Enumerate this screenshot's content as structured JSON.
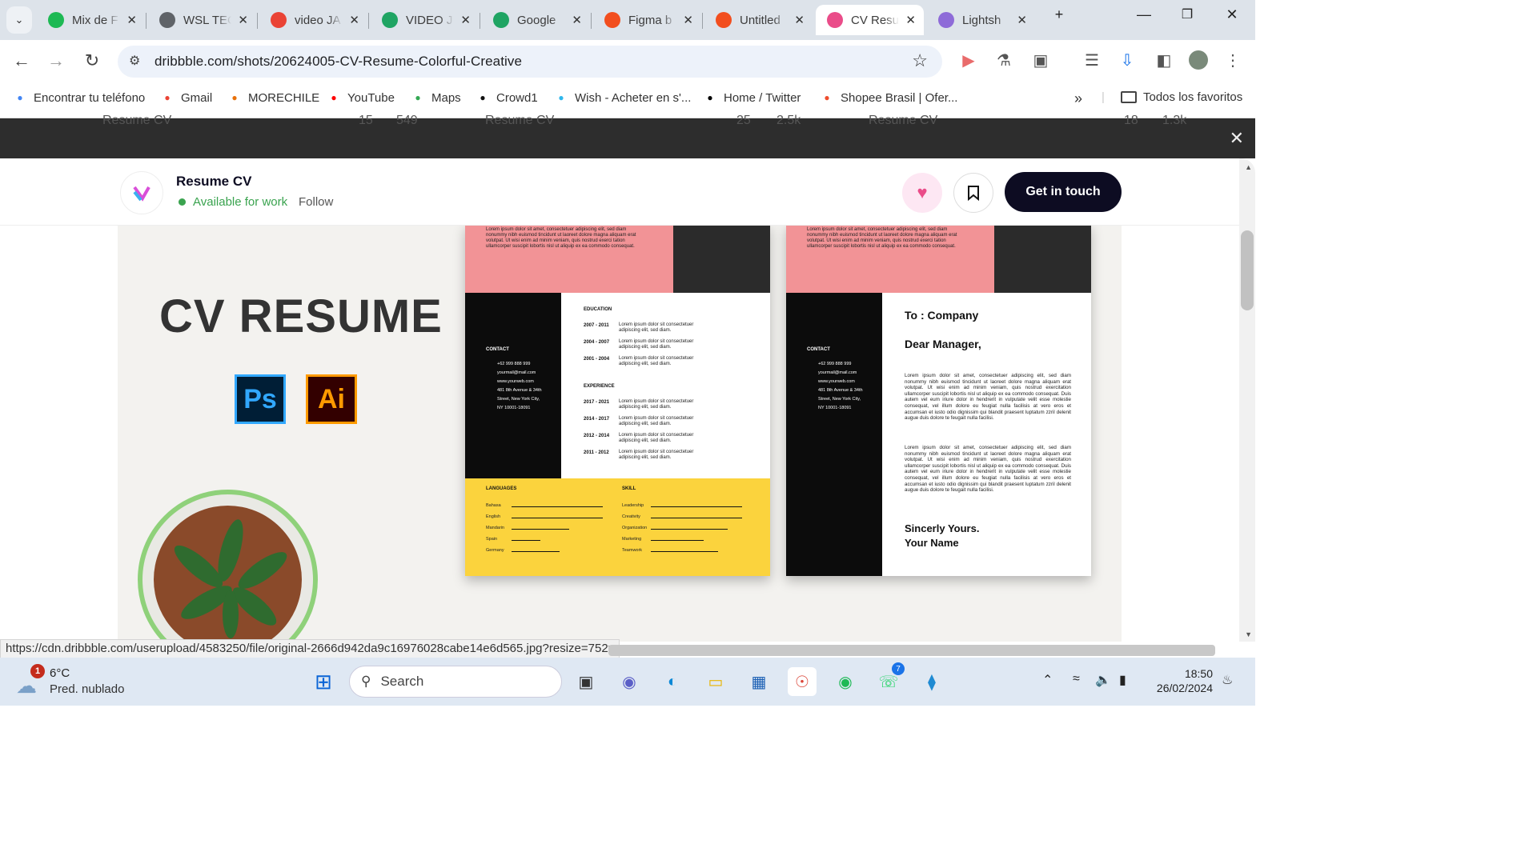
{
  "tabs": [
    {
      "label": "Mix de F",
      "icon": "spotify-icon",
      "color": "#1db954"
    },
    {
      "label": "WSL TEC",
      "icon": "globe-icon",
      "color": "#5f6368"
    },
    {
      "label": "video JA",
      "icon": "gmail-icon",
      "color": "#ea4335"
    },
    {
      "label": "VIDEO J",
      "icon": "drive-icon",
      "color": "#1fa463"
    },
    {
      "label": "Google",
      "icon": "drive-icon",
      "color": "#1fa463"
    },
    {
      "label": "Figma b",
      "icon": "figma-icon",
      "color": "#f24e1e"
    },
    {
      "label": "Untitled",
      "icon": "figma-icon",
      "color": "#f24e1e"
    },
    {
      "label": "CV Resu",
      "icon": "dribbble-icon",
      "color": "#ea4c89"
    },
    {
      "label": "Lightsh",
      "icon": "feather-icon",
      "color": "#8e6bd8"
    }
  ],
  "address": {
    "url": "dribbble.com/shots/20624005-CV-Resume-Colorful-Creative"
  },
  "bookmarks": [
    {
      "label": "Encontrar tu teléfono",
      "icon": "google-icon"
    },
    {
      "label": "Gmail",
      "icon": "gmail-icon"
    },
    {
      "label": "MORECHILE",
      "icon": "m-icon"
    },
    {
      "label": "YouTube",
      "icon": "youtube-icon"
    },
    {
      "label": "Maps",
      "icon": "maps-icon"
    },
    {
      "label": "Crowd1",
      "icon": "crowd1-icon"
    },
    {
      "label": "Wish - Acheter en s'...",
      "icon": "wish-icon"
    },
    {
      "label": "Home / Twitter",
      "icon": "x-icon"
    },
    {
      "label": "Shopee Brasil | Ofer...",
      "icon": "shopee-icon"
    }
  ],
  "bookmarks_all": "Todos los favoritos",
  "bookmarks_overflow": "»",
  "behind": {
    "shot1": "Resume CV",
    "shot2": "Resume CV",
    "shot3": "Resume CV",
    "s1a": "15",
    "s1b": "549",
    "s2a": "25",
    "s2b": "2.5k",
    "s3a": "18",
    "s3b": "1.3k"
  },
  "shot": {
    "title": "Resume CV",
    "availability": "Available for work",
    "follow": "Follow",
    "cta": "Get in touch",
    "like_color": "#ea4c89"
  },
  "artwork": {
    "headline": "CV RESUME",
    "app1": "Ps",
    "app2": "Ai",
    "lorem_top": "Lorem ipsum dolor sit amet, consectetuer adipiscing elit, sed diam nonummy nibh euismod tincidunt ut laoreet dolore magna aliquam erat volutpat. Ut wisi enim ad minim veniam, quis nostrud exerci tation ullamcorper suscipit lobortis nisl ut aliquip ex ea commodo consequat.",
    "contact_label": "CONTACT",
    "contact": [
      "+62 999 888 999",
      "yourmail@mail.com",
      "www.yourweb.com",
      "481 8th Avenue & 34th",
      "Street, New York City,",
      "NY 10001-18091"
    ],
    "education_label": "EDUCATION",
    "education": [
      "2007 - 2011",
      "2004 - 2007",
      "2001 - 2004"
    ],
    "experience_label": "EXPERIENCE",
    "experience": [
      "2017 - 2021",
      "2014 - 2017",
      "2012 - 2014",
      "2011 - 2012"
    ],
    "entry_text": "Lorem ipsum dolor sit consectetuer adipiscing elit, sed diam.",
    "languages_label": "LANGUAGES",
    "languages": [
      {
        "name": "Bahasa",
        "level": 0.95
      },
      {
        "name": "English",
        "level": 0.95
      },
      {
        "name": "Mandarin",
        "level": 0.6
      },
      {
        "name": "Spain",
        "level": 0.3
      },
      {
        "name": "Germany",
        "level": 0.5
      }
    ],
    "skills_label": "SKILL",
    "skills": [
      {
        "name": "Leadership",
        "level": 0.95
      },
      {
        "name": "Creativity",
        "level": 0.95
      },
      {
        "name": "Organization",
        "level": 0.8
      },
      {
        "name": "Marketing",
        "level": 0.55
      },
      {
        "name": "Teamwork",
        "level": 0.7
      }
    ],
    "letter_to": "To : Company",
    "letter_dear": "Dear Manager,",
    "letter_body": "Lorem ipsum dolor sit amet, consectetuer adipiscing elit, sed diam nonummy nibh euismod tincidunt ut laoreet dolore magna aliquam erat volutpat. Ut wisi enim ad minim veniam, quis nostrud exercitation ullamcorper suscipit lobortis nisl ut aliquip ex ea commodo consequat. Duis autem vel eum iriure dolor in hendrerit in vulputate velit esse molestie consequat, vel illum dolore eu feugiat nulla facilisis at vero eros et accumsan et iusto odio dignissim qui blandit praesent luptatum zzril delenit augue duis dolore te feugait nulla facilisi.",
    "letter_sign1": "Sincerly Yours.",
    "letter_sign2": "Your Name"
  },
  "status_url": "https://cdn.dribbble.com/userupload/4583250/file/original-2666d942da9c16976028cabe14e6d565.jpg?resize=752x",
  "taskbar": {
    "weather_badge": "1",
    "weather_temp": "6°C",
    "weather_desc": "Pred. nublado",
    "search": "Search",
    "whatsapp_badge": "7",
    "time": "18:50",
    "date": "26/02/2024"
  }
}
